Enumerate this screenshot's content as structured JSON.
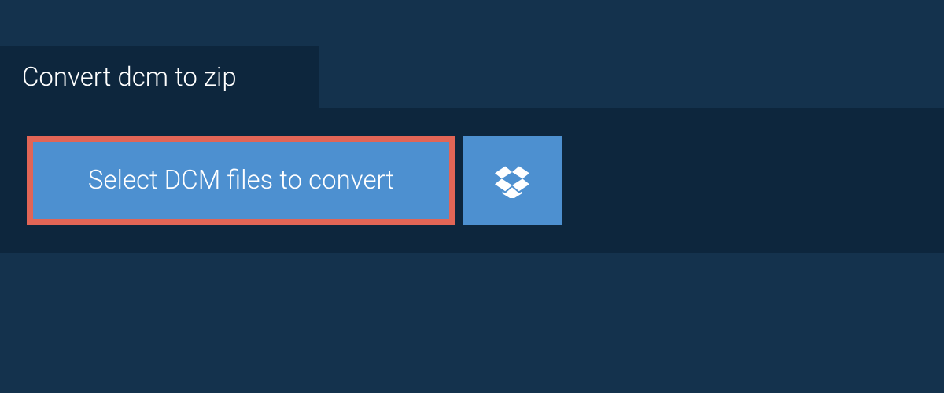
{
  "colors": {
    "outerBackground": "#14324d",
    "panelBackground": "#0d263d",
    "buttonBackground": "#4d90d0",
    "highlightBorder": "#e16556",
    "text": "#ffffff"
  },
  "tab": {
    "label": "Convert dcm to zip"
  },
  "actions": {
    "select_label": "Select DCM files to convert",
    "dropbox_icon": "dropbox"
  }
}
